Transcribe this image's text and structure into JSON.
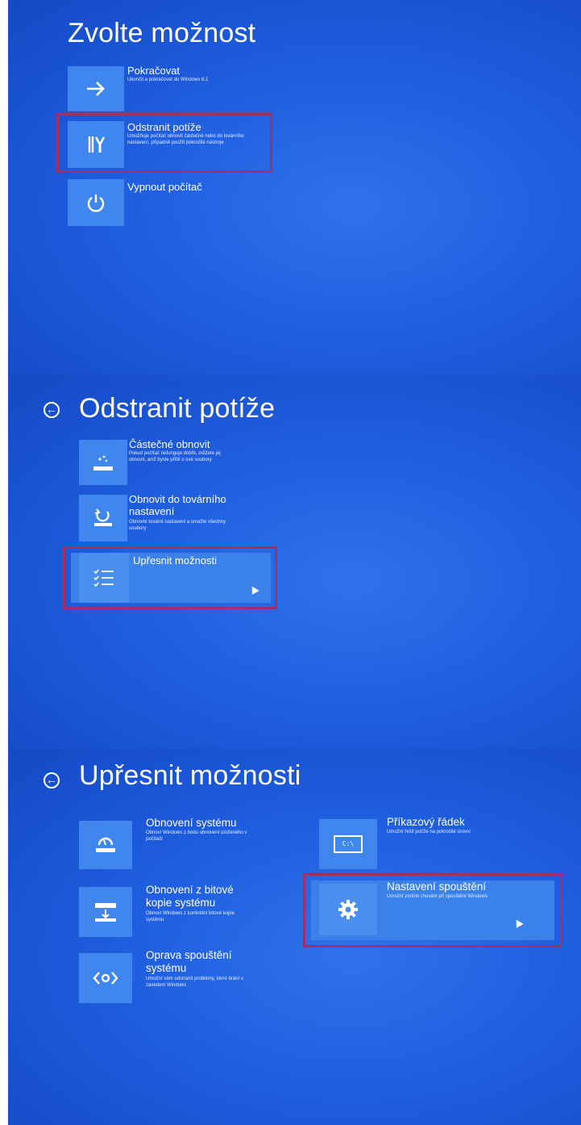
{
  "screen1": {
    "title": "Zvolte možnost",
    "items": [
      {
        "title": "Pokračovat",
        "desc": "Ukončit a pokračovat do Windows 8.1",
        "icon": "arrow-right-icon"
      },
      {
        "title": "Odstranit potíže",
        "desc": "Umožňuje počítač obnovit částečně nebo do továrního nastavení, případně použít pokročilé nástroje",
        "icon": "tools-icon"
      },
      {
        "title": "Vypnout počítač",
        "desc": "",
        "icon": "power-icon"
      }
    ]
  },
  "screen2": {
    "title": "Odstranit potíže",
    "items": [
      {
        "title": "Částečné obnovit",
        "desc": "Pokud počítač nefunguje dobře, můžete jej obnovit, aniž byste přišli o své soubory",
        "icon": "refresh-partial-icon"
      },
      {
        "title": "Obnovit do továrního nastavení",
        "title_line1": "Obnovit do továrního",
        "title_line2": "nastavení",
        "desc": "Obnovte tovární nastavení a smažte všechny soubory",
        "icon": "factory-reset-icon"
      },
      {
        "title": "Upřesnit možnosti",
        "desc": "",
        "icon": "checklist-icon"
      }
    ]
  },
  "screen3": {
    "title": "Upřesnit možnosti",
    "items": [
      {
        "title": "Obnovení systému",
        "desc": "Obnoví Windows z bodu obnovení uloženého v počítači",
        "icon": "system-restore-icon"
      },
      {
        "title_line1": "Obnovení z bitové",
        "title_line2": "kopie systému",
        "desc": "Obnoví Windows z konkrétní bitové kopie systému",
        "icon": "image-recovery-icon"
      },
      {
        "title_line1": "Oprava spouštění",
        "title_line2": "systému",
        "desc": "Umožní vám odstranit problémy, které brání v zavedení Windows",
        "icon": "startup-repair-icon"
      },
      {
        "title": "Příkazový řádek",
        "desc": "Umožní řešit potíže na pokročilé úrovni",
        "icon": "command-prompt-icon",
        "icon_text": "C:\\"
      },
      {
        "title": "Nastavení spouštění",
        "desc": "Umožní změnit chování při spouštění Windows",
        "icon": "gear-icon"
      }
    ]
  },
  "colors": {
    "background": "#1f5fe0",
    "tile": "#3f86ee",
    "highlight": "#a0306a"
  }
}
